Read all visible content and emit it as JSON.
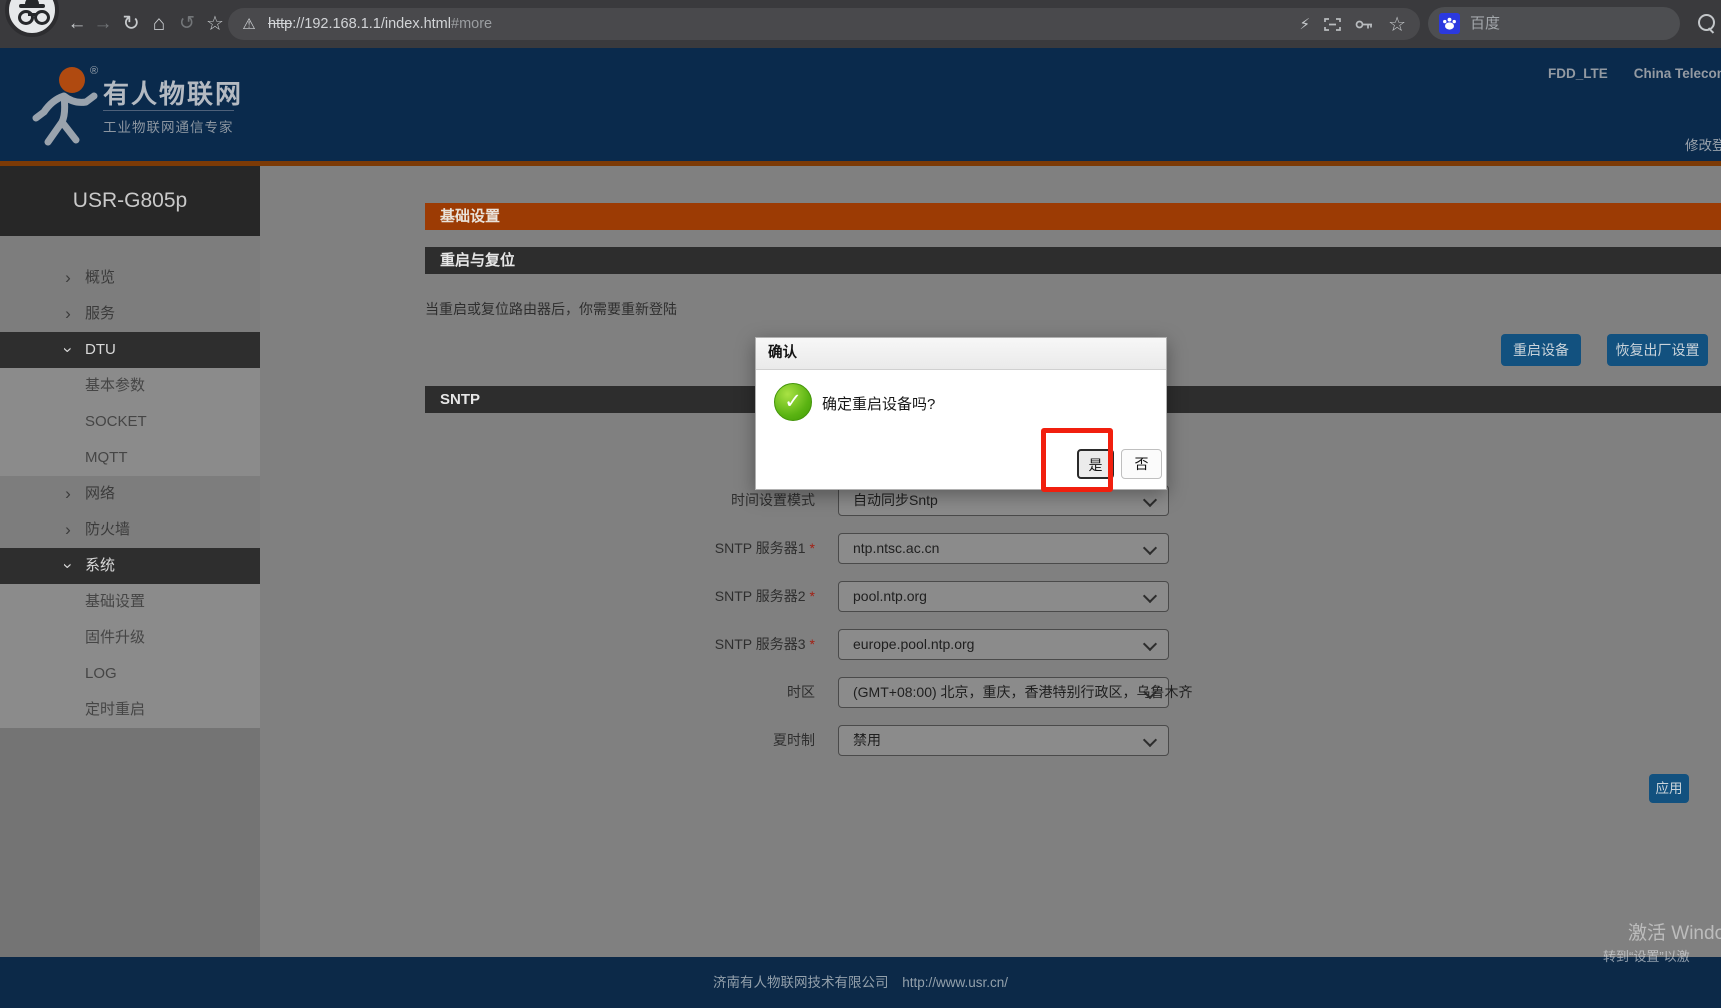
{
  "browser": {
    "url_scheme": "http",
    "url_rest": "://192.168.1.1/index.html",
    "url_fragment": "#more",
    "search_engine_label": "百度"
  },
  "header": {
    "brand": "有人物联网",
    "tagline": "工业物联网通信专家",
    "network": "FDD_LTE",
    "carrier": "China Telecom",
    "change_password": "修改登录密码"
  },
  "sidebar": {
    "device_model": "USR-G805p",
    "items": [
      {
        "label": "概览",
        "level": 1,
        "expanded": false,
        "selected": false
      },
      {
        "label": "服务",
        "level": 1,
        "expanded": false,
        "selected": false
      },
      {
        "label": "DTU",
        "level": 1,
        "expanded": true,
        "selected": true
      },
      {
        "label": "基本参数",
        "level": 2,
        "selected": false
      },
      {
        "label": "SOCKET",
        "level": 2,
        "selected": false
      },
      {
        "label": "MQTT",
        "level": 2,
        "selected": false
      },
      {
        "label": "网络",
        "level": 1,
        "expanded": false,
        "selected": false
      },
      {
        "label": "防火墙",
        "level": 1,
        "expanded": false,
        "selected": false
      },
      {
        "label": "系统",
        "level": 1,
        "expanded": true,
        "selected": true
      },
      {
        "label": "基础设置",
        "level": 2,
        "selected": true
      },
      {
        "label": "固件升级",
        "level": 2,
        "selected": false
      },
      {
        "label": "LOG",
        "level": 2,
        "selected": false
      },
      {
        "label": "定时重启",
        "level": 2,
        "selected": false
      }
    ]
  },
  "main": {
    "page_title": "基础设置",
    "restart": {
      "title": "重启与复位",
      "note": "当重启或复位路由器后，你需要重新登陆",
      "restart_button": "重启设备",
      "factory_button": "恢复出厂设置"
    },
    "sntp": {
      "title": "SNTP",
      "required_marker": "*",
      "rows": [
        {
          "label": "时间设置模式",
          "required": false,
          "value": "自动同步Sntp"
        },
        {
          "label": "SNTP 服务器1",
          "required": true,
          "value": "ntp.ntsc.ac.cn"
        },
        {
          "label": "SNTP 服务器2",
          "required": true,
          "value": "pool.ntp.org"
        },
        {
          "label": "SNTP 服务器3",
          "required": true,
          "value": "europe.pool.ntp.org"
        },
        {
          "label": "时区",
          "required": false,
          "value": "(GMT+08:00) 北京，重庆，香港特别行政区，乌鲁木齐"
        },
        {
          "label": "夏时制",
          "required": false,
          "value": "禁用"
        }
      ],
      "apply_button": "应用"
    }
  },
  "dialog": {
    "title": "确认",
    "message": "确定重启设备吗?",
    "yes_label": "是",
    "no_label": "否"
  },
  "footer": {
    "company": "济南有人物联网技术有限公司",
    "website": "http://www.usr.cn/"
  },
  "watermark": {
    "line1": "激活 Windows",
    "line2": "转到“设置”以激"
  },
  "colors": {
    "header_navy": "#0a2a4c",
    "accent_orange": "#9c3b04",
    "section_dark": "#2d2d2d",
    "button_blue": "#12517f",
    "annotation_red": "#f11f0e",
    "dialog_green": "#5ab312"
  }
}
